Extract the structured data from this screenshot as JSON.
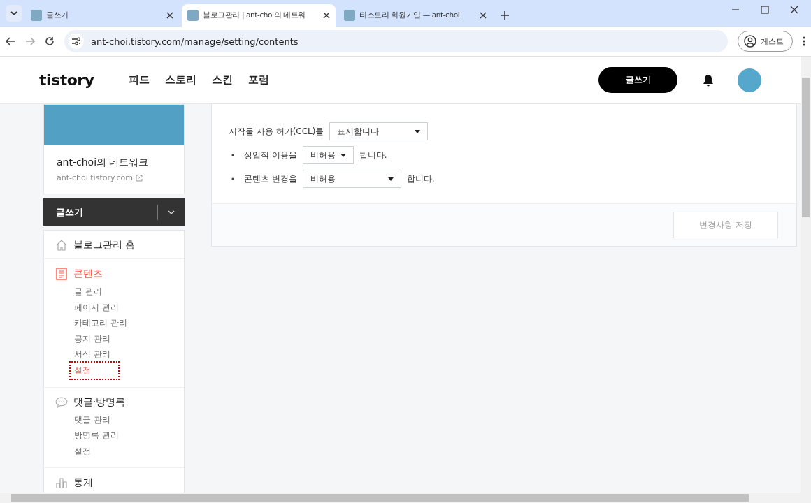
{
  "browser": {
    "tabs": [
      {
        "title": "글쓰기",
        "selected": false
      },
      {
        "title": "블로그관리 | ant-choi의 네트워",
        "selected": true
      },
      {
        "title": "티스토리 회원가입 — ant-choi",
        "selected": false
      }
    ],
    "address": "ant-choi.tistory.com/manage/setting/contents",
    "profile_label": "게스트"
  },
  "header": {
    "logo": "tistory",
    "nav": [
      "피드",
      "스토리",
      "스킨",
      "포럼"
    ],
    "write_button": "글쓰기"
  },
  "sidebar": {
    "blog_title": "ant-choi의 네트워크",
    "blog_url": "ant-choi.tistory.com",
    "write_button": "글쓰기",
    "menu": [
      {
        "kind": "home",
        "label": "블로그관리 홈",
        "selected": false
      },
      {
        "kind": "document",
        "label": "콘텐츠",
        "selected": true,
        "children": [
          {
            "label": "글 관리",
            "selected": false
          },
          {
            "label": "페이지 관리",
            "selected": false
          },
          {
            "label": "카테고리 관리",
            "selected": false
          },
          {
            "label": "공지 관리",
            "selected": false
          },
          {
            "label": "서식 관리",
            "selected": false
          },
          {
            "label": "설정",
            "selected": true
          }
        ]
      },
      {
        "kind": "comment",
        "label": "댓글·방명록",
        "selected": false,
        "children": [
          {
            "label": "댓글 관리",
            "selected": false
          },
          {
            "label": "방명록 관리",
            "selected": false
          },
          {
            "label": "설정",
            "selected": false
          }
        ]
      },
      {
        "kind": "chart",
        "label": "통계",
        "selected": false
      }
    ]
  },
  "content": {
    "ccl": {
      "label": "저작물 사용 허가(CCL)를",
      "value": "표시합니다"
    },
    "rows": [
      {
        "label": "상업적 이용을",
        "value": "비허용",
        "suffix": "합니다."
      },
      {
        "label": "콘텐츠 변경을",
        "value": "비허용",
        "suffix": "합니다."
      }
    ],
    "save_button": {
      "label": "변경사항 저장",
      "disabled": true
    }
  }
}
